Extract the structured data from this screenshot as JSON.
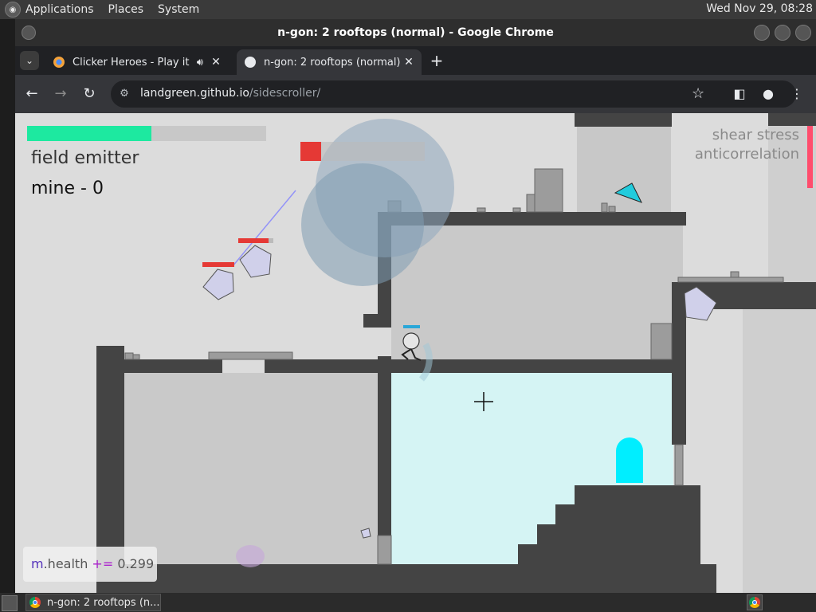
{
  "system_panel": {
    "menus": [
      "Applications",
      "Places",
      "System"
    ],
    "clock": "Wed Nov 29, 08:28"
  },
  "window": {
    "title": "n-gon: 2 rooftops (normal) - Google Chrome"
  },
  "tabs": [
    {
      "label": "Clicker Heroes - Play it now",
      "audio_icon": "speaker-icon",
      "close": "✕",
      "active": false
    },
    {
      "label": "n-gon: 2 rooftops (normal)",
      "close": "✕",
      "active": true
    }
  ],
  "toolbar": {
    "url_domain": "landgreen.github.io",
    "url_path": "/sidescroller/"
  },
  "game": {
    "field_label": "field emitter",
    "mine_label": "mine - 0",
    "stat_line1": "shear stress",
    "stat_line2": "anticorrelation",
    "health_fraction": 0.52,
    "console": {
      "object": "m",
      "prop": ".health ",
      "op": "+=",
      "value": " 0.299"
    },
    "colors": {
      "background": "#dcdcdc",
      "structure": "#444444",
      "health_bar": "#1de9a0",
      "water": "#d5f4f4",
      "portal": "#00eeff",
      "enemy_bar": "#e53935",
      "stat_bar": "#ff4d6d"
    }
  },
  "taskbar": {
    "task_label": "n-gon: 2 rooftops (n..."
  }
}
